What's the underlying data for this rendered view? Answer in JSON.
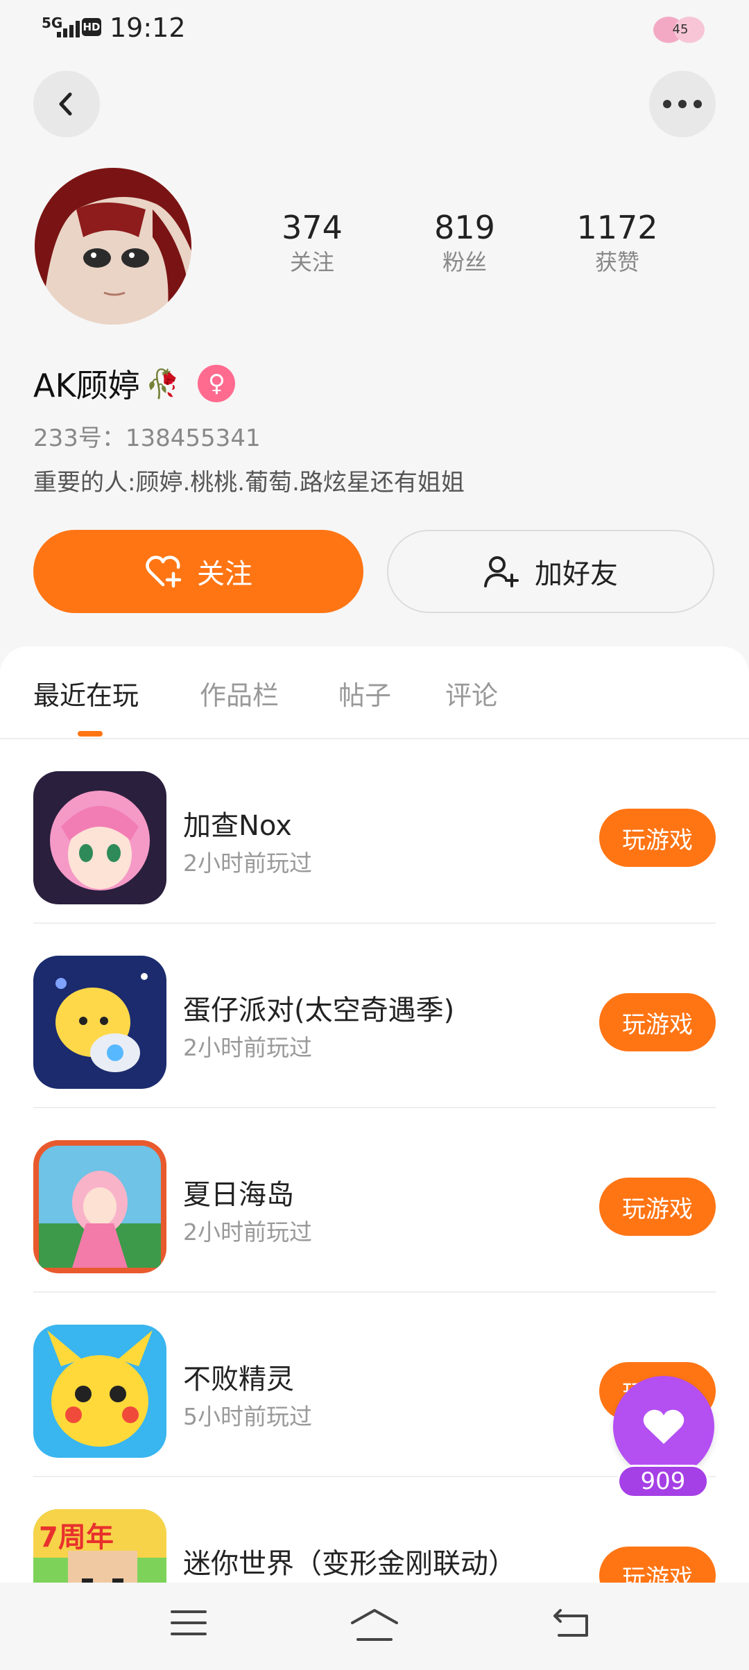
{
  "status_bar": {
    "network": "5G",
    "hd": "HD",
    "time": "19:12",
    "battery": "45"
  },
  "profile": {
    "name": "AK顾婷",
    "uid": "233号：138455341",
    "bio": "重要的人:顾婷.桃桃.葡萄.路炫星还有姐姐",
    "stats": [
      {
        "value": "374",
        "label": "关注"
      },
      {
        "value": "819",
        "label": "粉丝"
      },
      {
        "value": "1172",
        "label": "获赞"
      }
    ]
  },
  "actions": {
    "follow": "关注",
    "add_friend": "加好友"
  },
  "tabs": [
    "最近在玩",
    "作品栏",
    "帖子",
    "评论"
  ],
  "games": [
    {
      "title": "加查Nox",
      "time": "2小时前玩过",
      "button": "玩游戏"
    },
    {
      "title": "蛋仔派对(太空奇遇季)",
      "time": "2小时前玩过",
      "button": "玩游戏"
    },
    {
      "title": "夏日海岛",
      "time": "2小时前玩过",
      "button": "玩游戏"
    },
    {
      "title": "不败精灵",
      "time": "5小时前玩过",
      "button": "玩游戏"
    },
    {
      "title": "迷你世界（变形金刚联动）",
      "time": "",
      "button": "玩游戏",
      "badge": "7周年"
    }
  ],
  "floating": {
    "likes": "909"
  },
  "colors": {
    "accent": "#ff7514",
    "like": "#b44ff2",
    "gender": "#ff6b8f"
  }
}
